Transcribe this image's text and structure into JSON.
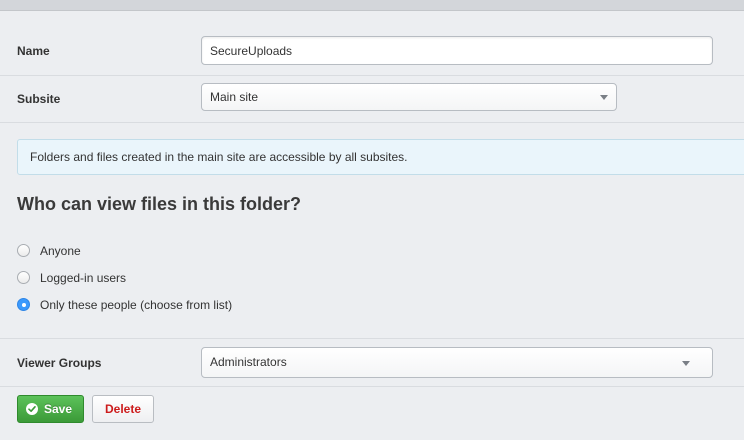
{
  "form": {
    "name_label": "Name",
    "name_value": "SecureUploads",
    "subsite_label": "Subsite",
    "subsite_value": "Main site"
  },
  "notice": {
    "text": "Folders and files created in the main site are accessible by all subsites."
  },
  "permissions": {
    "heading": "Who can view files in this folder?",
    "options": [
      {
        "label": "Anyone",
        "checked": false
      },
      {
        "label": "Logged-in users",
        "checked": false
      },
      {
        "label": "Only these people (choose from list)",
        "checked": true
      }
    ],
    "viewer_groups_label": "Viewer Groups",
    "viewer_groups_value": "Administrators"
  },
  "actions": {
    "save_label": "Save",
    "delete_label": "Delete"
  },
  "colors": {
    "save_button": "#3b9a38",
    "delete_text": "#cc1b1b",
    "radio_selected": "#3b99fc",
    "notice_background": "#eaf5fb"
  },
  "icons": {
    "save": "checkmark-icon",
    "dropdown": "chevron-down-icon"
  }
}
